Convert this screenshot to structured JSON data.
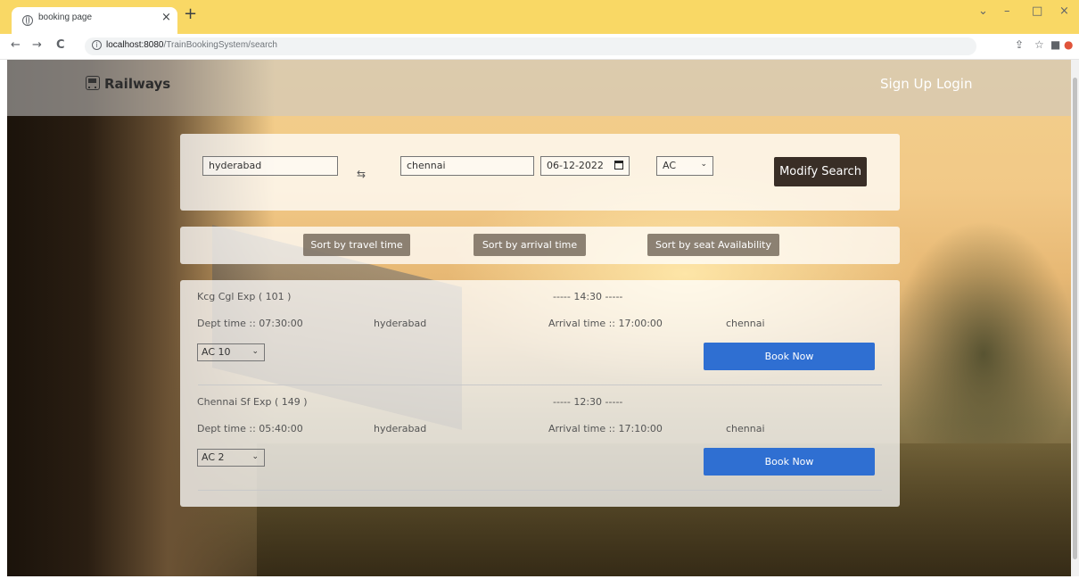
{
  "browser": {
    "tab_title": "booking page",
    "tab_close": "×",
    "new_tab": "+",
    "url_host": "localhost:8080",
    "url_path": "/TrainBookingSystem/search",
    "back": "←",
    "forward": "→",
    "reload": "C",
    "win_chevron": "⌄",
    "win_min": "–",
    "win_max": "□",
    "win_close": "×"
  },
  "nav": {
    "brand": "Railways",
    "signup": "Sign Up",
    "login": "Login"
  },
  "search": {
    "from": "hyderabad",
    "swap": "⇆",
    "to": "chennai",
    "date": "06-12-2022",
    "class": "AC",
    "modify_label": "Modify Search"
  },
  "sort": {
    "travel_time": "Sort by travel time",
    "arrival_time": "Sort by arrival time",
    "seat_availability": "Sort by seat Availability"
  },
  "trains": [
    {
      "name": "Kcg Cgl Exp ( 101 )",
      "duration": "----- 14:30 -----",
      "dept": "Dept time :: 07:30:00",
      "from": "hyderabad",
      "arrival": "Arrival time :: 17:00:00",
      "to": "chennai",
      "class": "AC 10",
      "book_label": "Book Now"
    },
    {
      "name": "Chennai Sf Exp ( 149 )",
      "duration": "----- 12:30 -----",
      "dept": "Dept time :: 05:40:00",
      "from": "hyderabad",
      "arrival": "Arrival time :: 17:10:00",
      "to": "chennai",
      "class": "AC 2",
      "book_label": "Book Now"
    }
  ]
}
